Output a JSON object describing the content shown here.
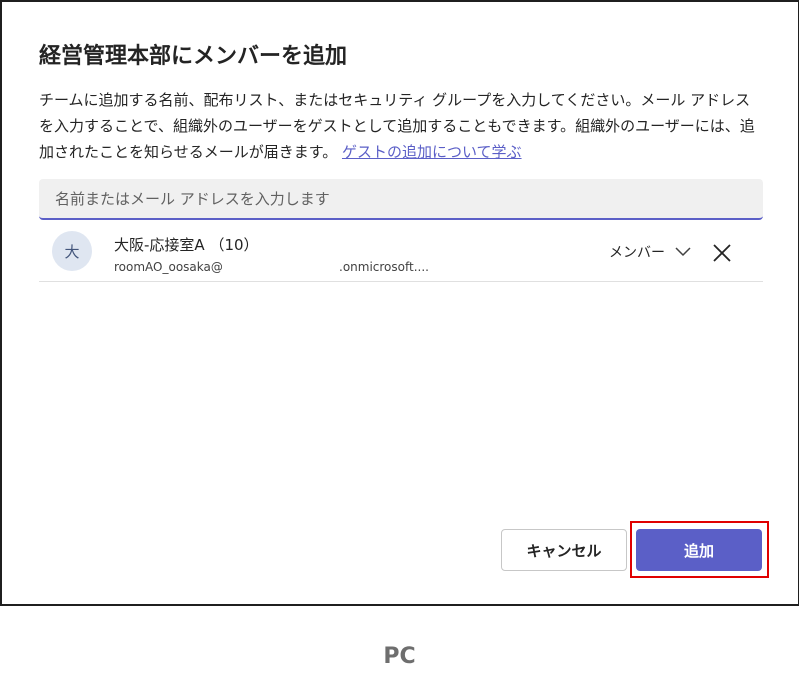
{
  "dialog": {
    "title": "経営管理本部にメンバーを追加",
    "description": "チームに追加する名前、配布リスト、またはセキュリティ グループを入力してください。メール アドレスを入力することで、組織外のユーザーをゲストとして追加することもできます。組織外のユーザーには、追加されたことを知らせるメールが届きます。",
    "learn_link": "ゲストの追加について学ぶ"
  },
  "search": {
    "placeholder": "名前またはメール アドレスを入力します",
    "value": ""
  },
  "member": {
    "avatar_initial": "大",
    "name": "大阪-応接室A （10）",
    "email": "roomAO_oosaka@",
    "domain": ".onmicrosoft....",
    "role": "メンバー"
  },
  "buttons": {
    "cancel": "キャンセル",
    "add": "追加"
  },
  "caption": "PC",
  "colors": {
    "accent": "#5b5fc7",
    "highlight": "#e00000",
    "avatar_bg": "#dfe6f1"
  }
}
